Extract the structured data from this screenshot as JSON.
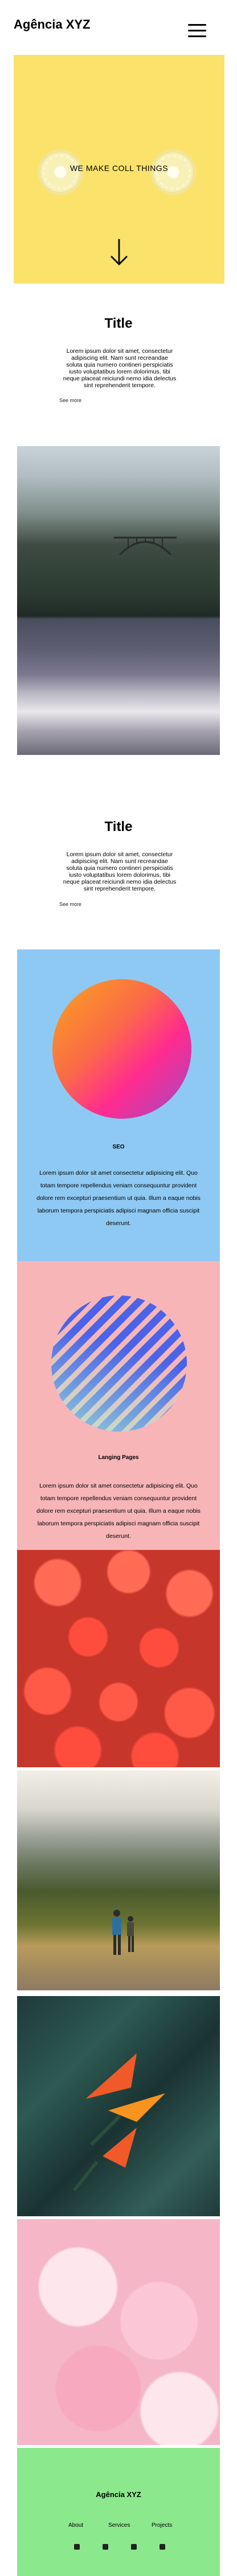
{
  "header": {
    "brand": "Agência XYZ",
    "menu_icon": "hamburger-menu-icon"
  },
  "hero": {
    "tagline": "WE MAKE COLL THINGS",
    "scroll_icon": "arrow-down-icon",
    "background_color": "#fbe26a"
  },
  "section1": {
    "title": "Title",
    "text": "Lorem ipsum dolor sit amet, consectetur adipiscing elit. Nam sunt recreandae soluta quia numero contineri perspiciatis iusto voluptatibus lorem dolorimus, tibi neque placeat reiciundi nemo idia delectus sint reprehenderit tempore.",
    "see_more": "See more"
  },
  "section2": {
    "title": "Title",
    "text": "Lorem ipsum dolor sit amet, consectetur adipiscing elit. Nam sunt recreandae soluta quia numero contineri perspiciatis iusto voluptatibus lorem dolorimus, tibi neque placeat reiciundi nemo idia delectus sint reprehenderit tempore.",
    "see_more": "See more"
  },
  "card_blue": {
    "label": "SEO",
    "text": "Lorem ipsum dolor sit amet consectetur adipisicing elit. Quo totam tempore repellendus veniam consequuntur provident dolore rem excepturi praesentium ut quia. Illum a eaque nobis laborum tempora perspiciatis adipisci magnam officia suscipit deserunt.",
    "background_color": "#8ec9f3"
  },
  "card_pink": {
    "label": "Langing Pages",
    "text": "Lorem ipsum dolor sit amet consectetur adipisicing elit. Quo totam tempore repellendus veniam consequuntur provident dolore rem excepturi praesentium ut quia. Illum a eaque nobis laborum tempora perspiciatis adipisci magnam officia suscipit deserunt.",
    "background_color": "#f7b5b8"
  },
  "footer": {
    "brand": "Agência XYZ",
    "links": [
      "About",
      "Services",
      "Projects"
    ],
    "social_icons": [
      "facebook-icon",
      "instagram-icon",
      "twitter-icon",
      "linkedin-icon"
    ],
    "background_color": "#8ce88c"
  }
}
